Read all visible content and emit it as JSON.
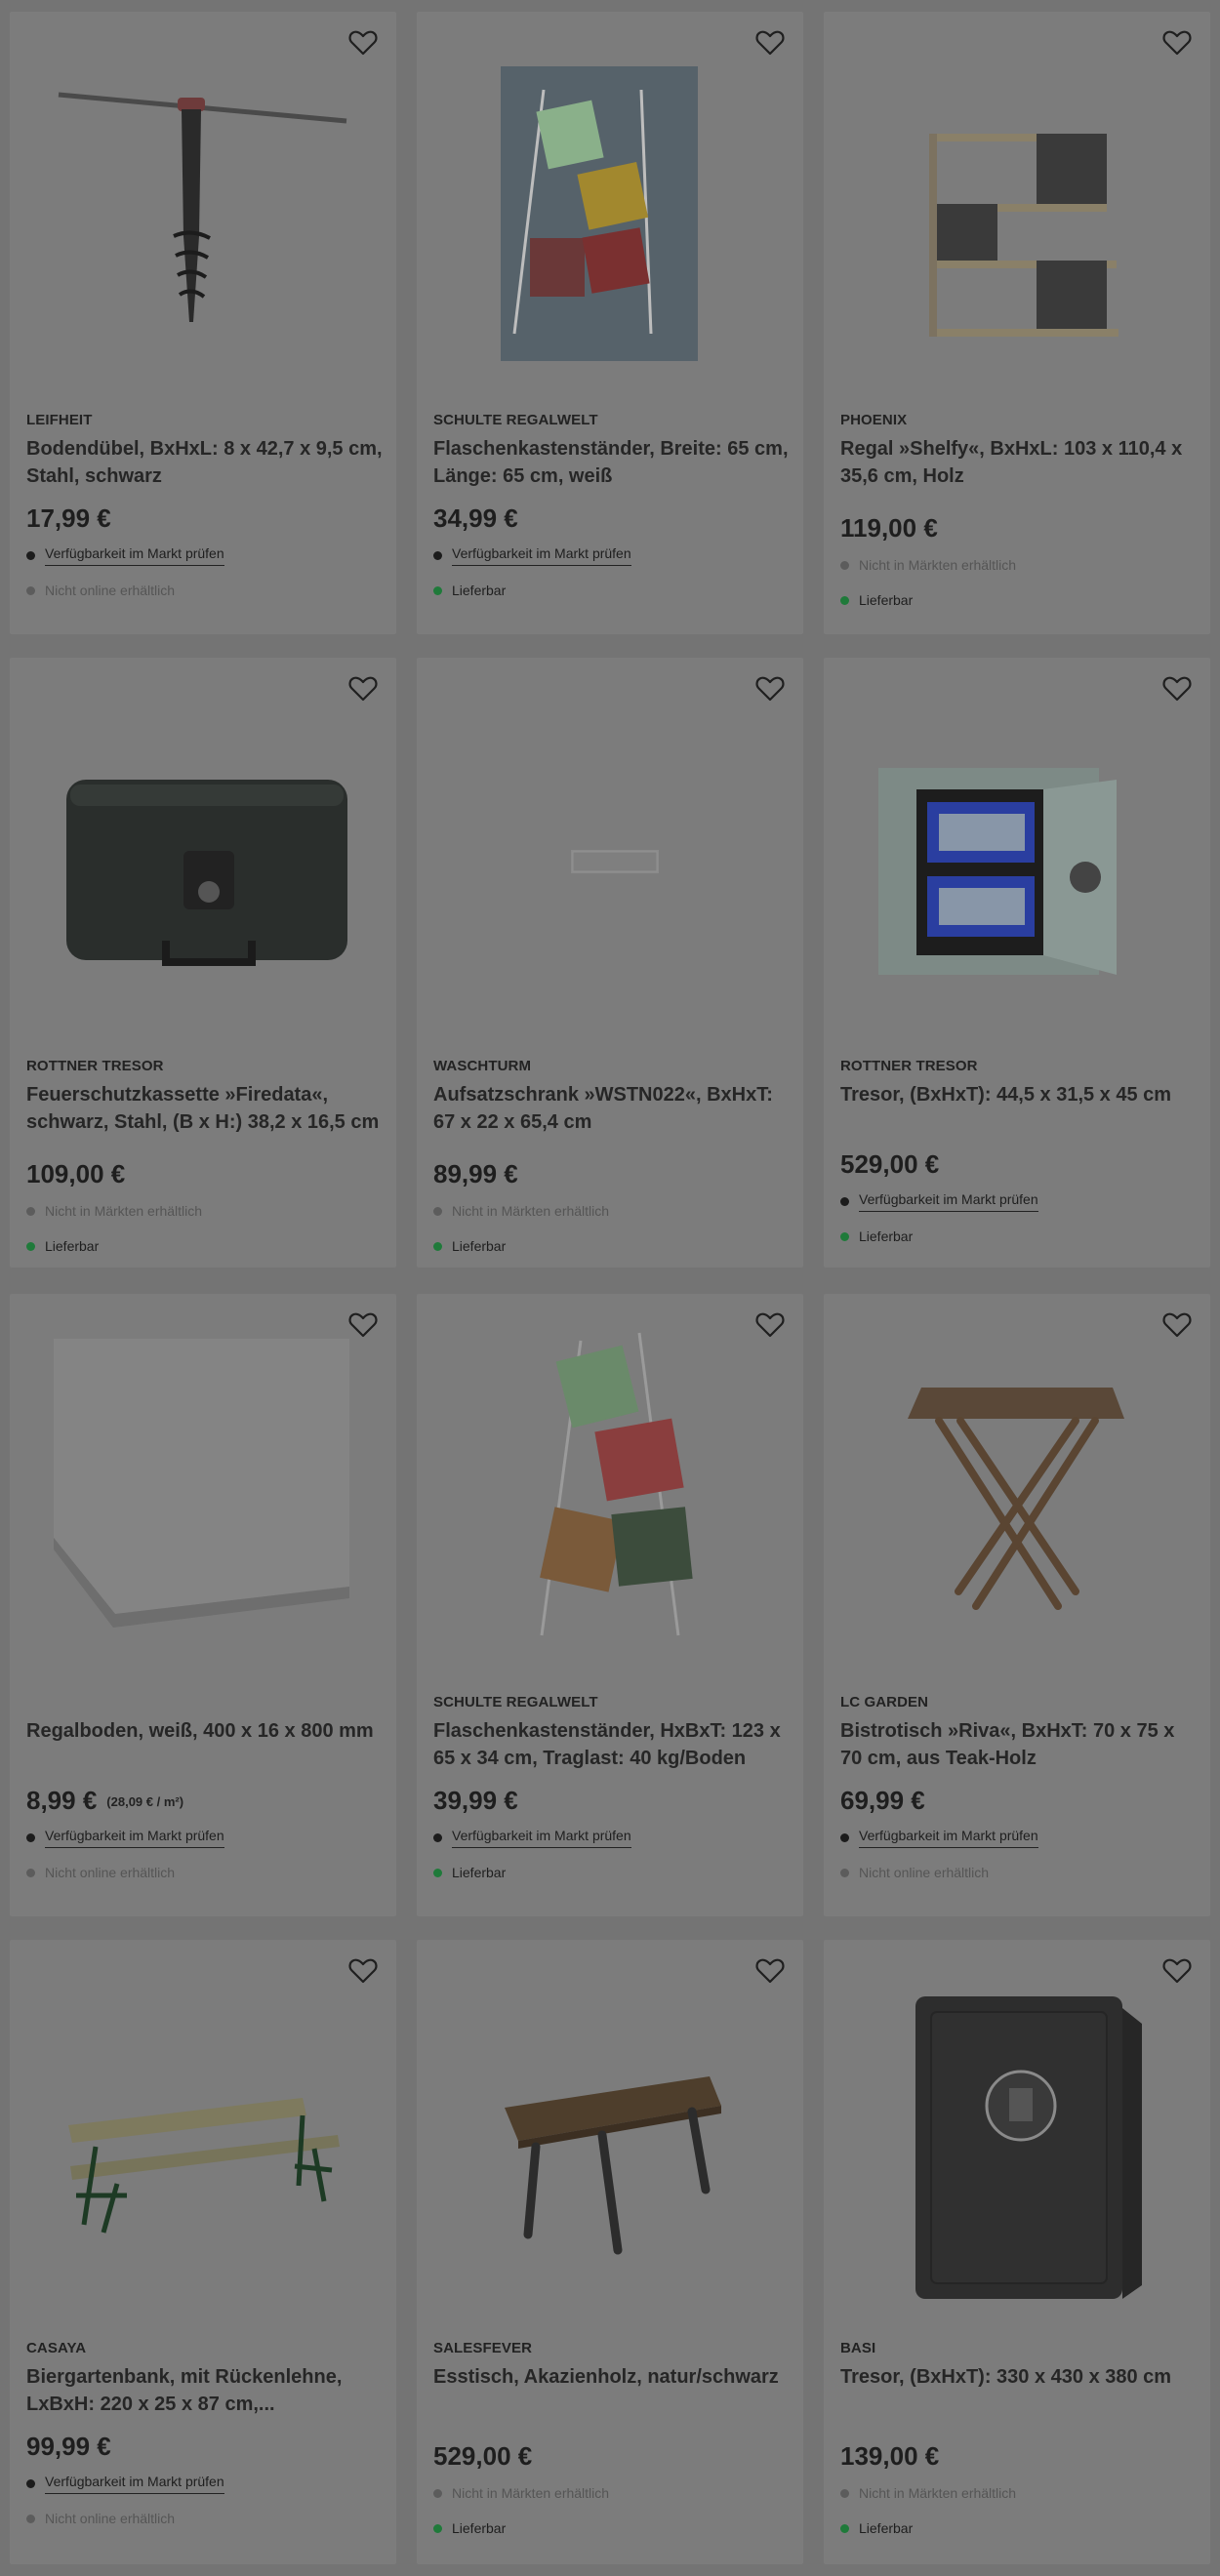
{
  "products": [
    {
      "brand": "LEIFHEIT",
      "title": "Bodendübel, BxHxL: 8 x 42,7 x 9,5 cm, Stahl, schwarz",
      "price": "17,99 €",
      "unit_price": "",
      "availability": [
        {
          "kind": "link",
          "text": "Verfügbarkeit im Markt prüfen"
        },
        {
          "kind": "muted",
          "text": "Nicht online erhältlich"
        }
      ],
      "icon": "ground-anchor-image"
    },
    {
      "brand": "SCHULTE REGALWELT",
      "title": "Flaschenkastenständer, Breite: 65 cm, Länge: 65 cm, weiß",
      "price": "34,99 €",
      "unit_price": "",
      "availability": [
        {
          "kind": "link",
          "text": "Verfügbarkeit im Markt prüfen"
        },
        {
          "kind": "green",
          "text": "Lieferbar"
        }
      ],
      "icon": "crate-stand-image"
    },
    {
      "brand": "PHOENIX",
      "title": "Regal »Shelfy«, BxHxL: 103 x 110,4 x 35,6 cm, Holz",
      "price": "119,00 €",
      "unit_price": "",
      "availability": [
        {
          "kind": "muted",
          "text": "Nicht in Märkten erhältlich"
        },
        {
          "kind": "green",
          "text": "Lieferbar"
        }
      ],
      "icon": "shelf-image"
    },
    {
      "brand": "ROTTNER TRESOR",
      "title": "Feuerschutzkassette »Firedata«, schwarz, Stahl, (B x H:) 38,2 x 16,5 cm",
      "price": "109,00 €",
      "unit_price": "",
      "availability": [
        {
          "kind": "muted",
          "text": "Nicht in Märkten erhältlich"
        },
        {
          "kind": "green",
          "text": "Lieferbar"
        }
      ],
      "icon": "fire-box-image"
    },
    {
      "brand": "WASCHTURM",
      "title": "Aufsatzschrank »WSTN022«, BxHxT: 67 x 22 x 65,4 cm",
      "price": "89,99 €",
      "unit_price": "",
      "availability": [
        {
          "kind": "muted",
          "text": "Nicht in Märkten erhältlich"
        },
        {
          "kind": "green",
          "text": "Lieferbar"
        }
      ],
      "icon": "cabinet-image"
    },
    {
      "brand": "ROTTNER TRESOR",
      "title": "Tresor, (BxHxT): 44,5 x 31,5 x 45 cm",
      "price": "529,00 €",
      "unit_price": "",
      "availability": [
        {
          "kind": "link",
          "text": "Verfügbarkeit im Markt prüfen"
        },
        {
          "kind": "green",
          "text": "Lieferbar"
        }
      ],
      "icon": "safe-open-image"
    },
    {
      "brand": "",
      "title": "Regalboden, weiß, 400 x 16 x 800 mm",
      "price": "8,99 €",
      "unit_price": "(28,09 € / m²)",
      "availability": [
        {
          "kind": "link",
          "text": "Verfügbarkeit im Markt prüfen"
        },
        {
          "kind": "muted",
          "text": "Nicht online erhältlich"
        }
      ],
      "icon": "shelf-board-image"
    },
    {
      "brand": "SCHULTE REGALWELT",
      "title": "Flaschenkastenständer, HxBxT: 123 x 65 x 34 cm, Traglast: 40 kg/Boden",
      "price": "39,99 €",
      "unit_price": "",
      "availability": [
        {
          "kind": "link",
          "text": "Verfügbarkeit im Markt prüfen"
        },
        {
          "kind": "green",
          "text": "Lieferbar"
        }
      ],
      "icon": "crate-tower-image"
    },
    {
      "brand": "LC GARDEN",
      "title": "Bistrotisch »Riva«, BxHxT: 70 x 75 x 70 cm, aus Teak-Holz",
      "price": "69,99 €",
      "unit_price": "",
      "availability": [
        {
          "kind": "link",
          "text": "Verfügbarkeit im Markt prüfen"
        },
        {
          "kind": "muted",
          "text": "Nicht online erhältlich"
        }
      ],
      "icon": "bistro-table-image"
    },
    {
      "brand": "CASAYA",
      "title": "Biergartenbank, mit Rückenlehne, LxBxH: 220 x 25 x 87 cm,...",
      "price": "99,99 €",
      "unit_price": "",
      "availability": [
        {
          "kind": "link",
          "text": "Verfügbarkeit im Markt prüfen"
        },
        {
          "kind": "muted",
          "text": "Nicht online erhältlich"
        }
      ],
      "icon": "bench-image"
    },
    {
      "brand": "SALESFEVER",
      "title": "Esstisch, Akazienholz, natur/schwarz",
      "price": "529,00 €",
      "unit_price": "",
      "availability": [
        {
          "kind": "muted",
          "text": "Nicht in Märkten erhältlich"
        },
        {
          "kind": "green",
          "text": "Lieferbar"
        }
      ],
      "icon": "dining-table-image"
    },
    {
      "brand": "BASI",
      "title": "Tresor, (BxHxT): 330 x 430 x 380 cm",
      "price": "139,00 €",
      "unit_price": "",
      "availability": [
        {
          "kind": "muted",
          "text": "Nicht in Märkten erhältlich"
        },
        {
          "kind": "green",
          "text": "Lieferbar"
        }
      ],
      "icon": "safe-closed-image"
    }
  ],
  "colors": {
    "overlay": "#747474",
    "card": "#7c7c7c",
    "available": "#1f7a3a",
    "unavailable": "#5c5c5c"
  }
}
